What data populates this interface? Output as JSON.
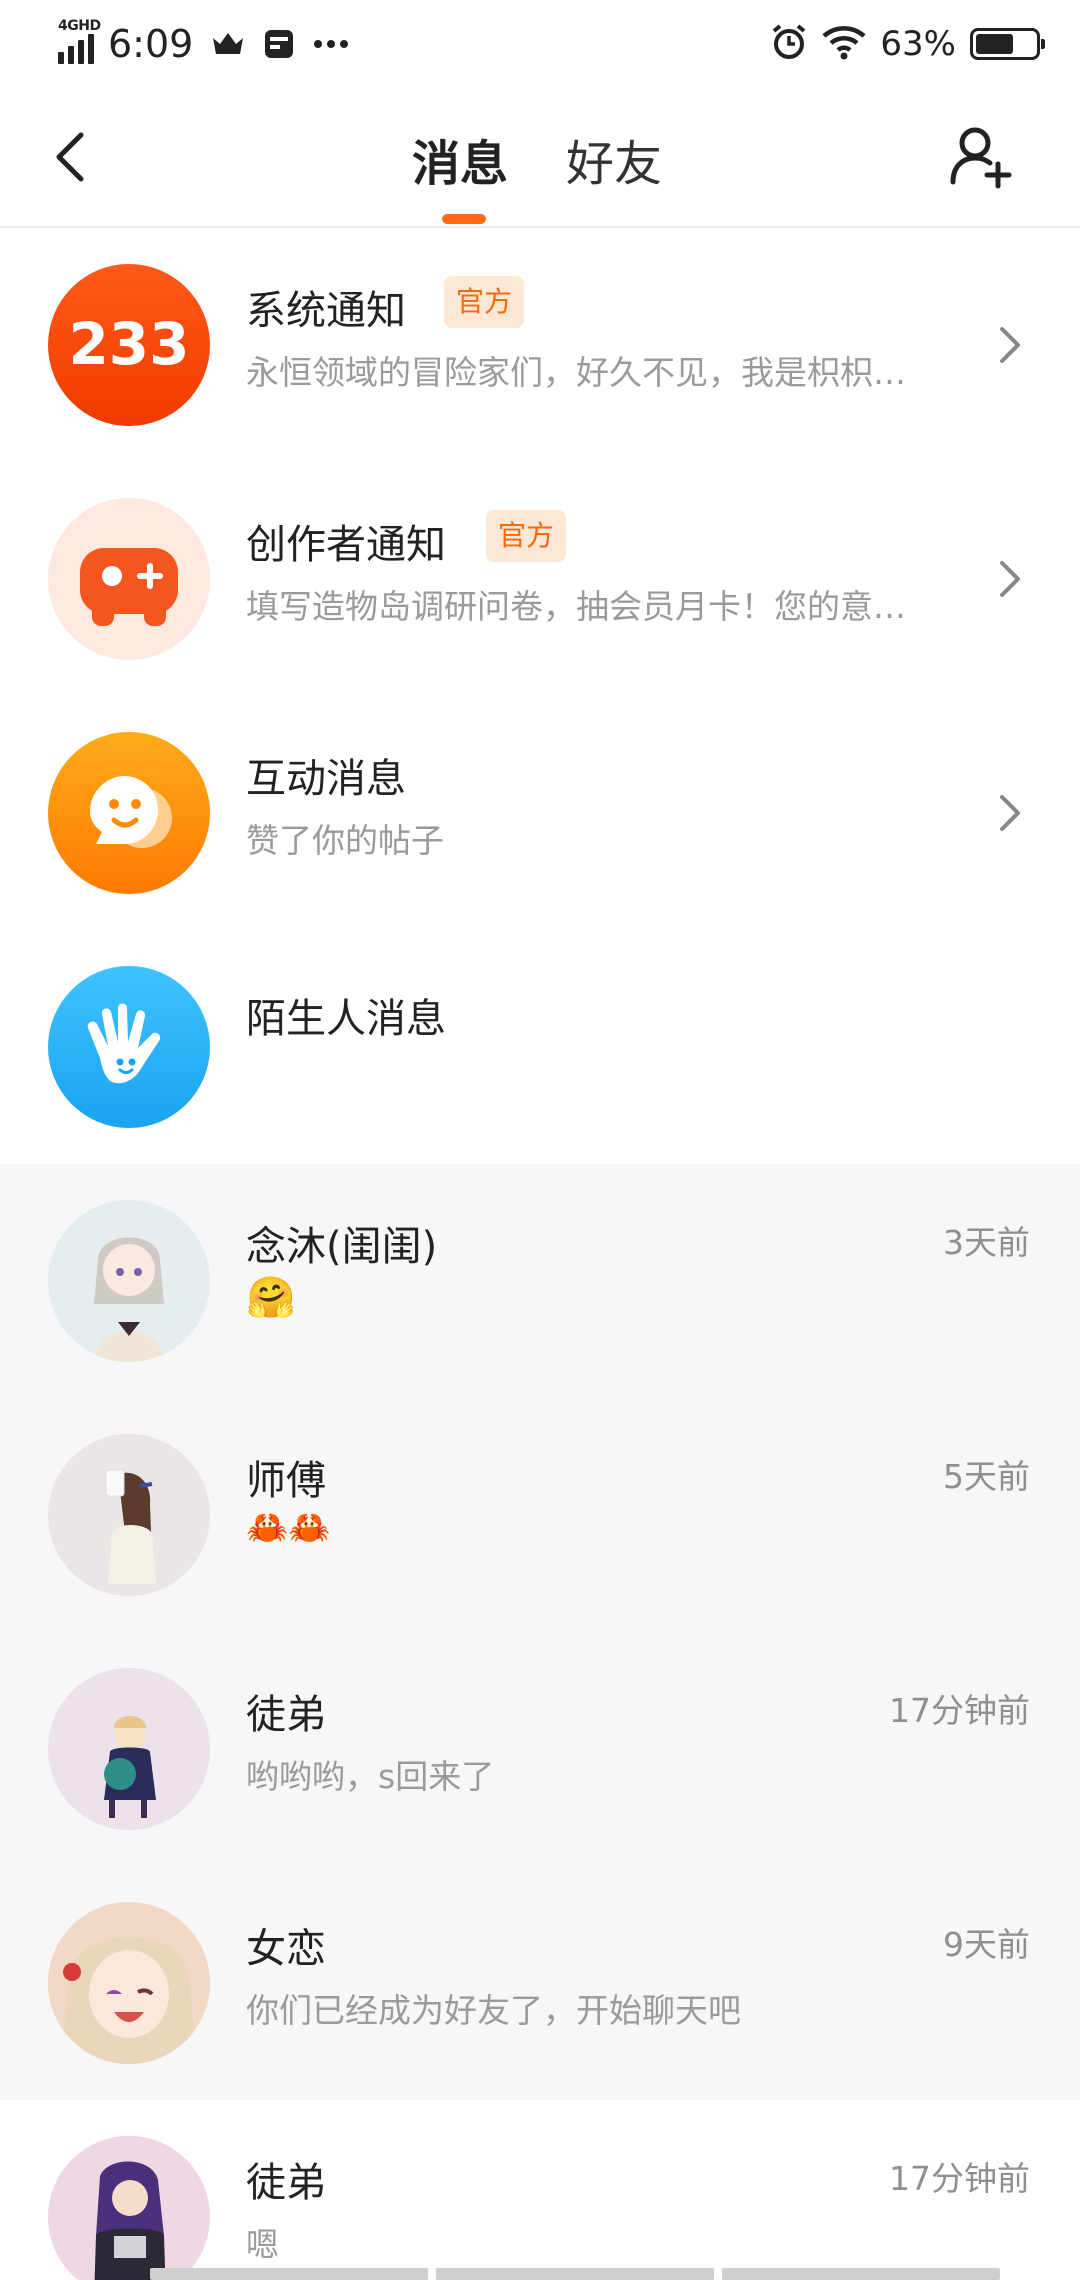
{
  "status_bar": {
    "network": "4GHD",
    "time": "6:09",
    "battery_percent": "63%",
    "battery_level": 0.63,
    "icons": [
      "signal-icon",
      "crown-icon",
      "card-icon",
      "more-icon",
      "alarm-icon",
      "wifi-icon",
      "battery-icon"
    ]
  },
  "header": {
    "tabs": [
      {
        "label": "消息",
        "active": true
      },
      {
        "label": "好友",
        "active": false
      }
    ],
    "accent_color": "#ff6a12"
  },
  "system_rows": [
    {
      "title": "系统通知",
      "badge": "官方",
      "subtitle": "永恒领域的冒险家们，好久不见，我是枳枳…"
    },
    {
      "title": "创作者通知",
      "badge": "官方",
      "subtitle": "填写造物岛调研问卷，抽会员月卡！您的意…"
    },
    {
      "title": "互动消息",
      "subtitle": "赞了你的帖子"
    },
    {
      "title": "陌生人消息"
    }
  ],
  "system_icons": {
    "system_avatar_text": "233"
  },
  "chats": [
    {
      "name": "念沐(闺闺)",
      "time": "3天前",
      "preview_emoji": "🤗"
    },
    {
      "name": "师傅",
      "time": "5天前",
      "preview_emoji": "🦀🦀"
    },
    {
      "name": "徒弟",
      "time": "17分钟前",
      "preview": "哟哟哟，s回来了"
    },
    {
      "name": "女恋",
      "time": "9天前",
      "preview": "你们已经成为好友了，开始聊天吧"
    },
    {
      "name": "徒弟",
      "time": "17分钟前",
      "preview": "嗯"
    }
  ]
}
